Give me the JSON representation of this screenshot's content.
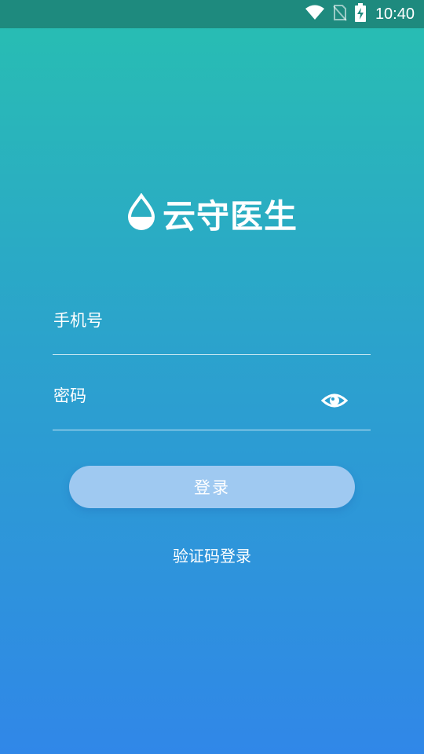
{
  "status_bar": {
    "time": "10:40",
    "icons": [
      "wifi-icon",
      "no-sim-icon",
      "battery-charging-icon"
    ]
  },
  "app": {
    "name": "云守医生",
    "logo_icon": "water-drop-icon"
  },
  "form": {
    "phone_placeholder": "手机号",
    "password_placeholder": "密码",
    "password_toggle_icon": "eye-icon"
  },
  "actions": {
    "login_label": "登录",
    "sms_login_label": "验证码登录"
  },
  "colors": {
    "gradient_top": "#28bfb1",
    "gradient_bottom": "#3087e8",
    "button_bg": "#9fc9f1",
    "status_bar_bg": "#1e8a7e"
  }
}
